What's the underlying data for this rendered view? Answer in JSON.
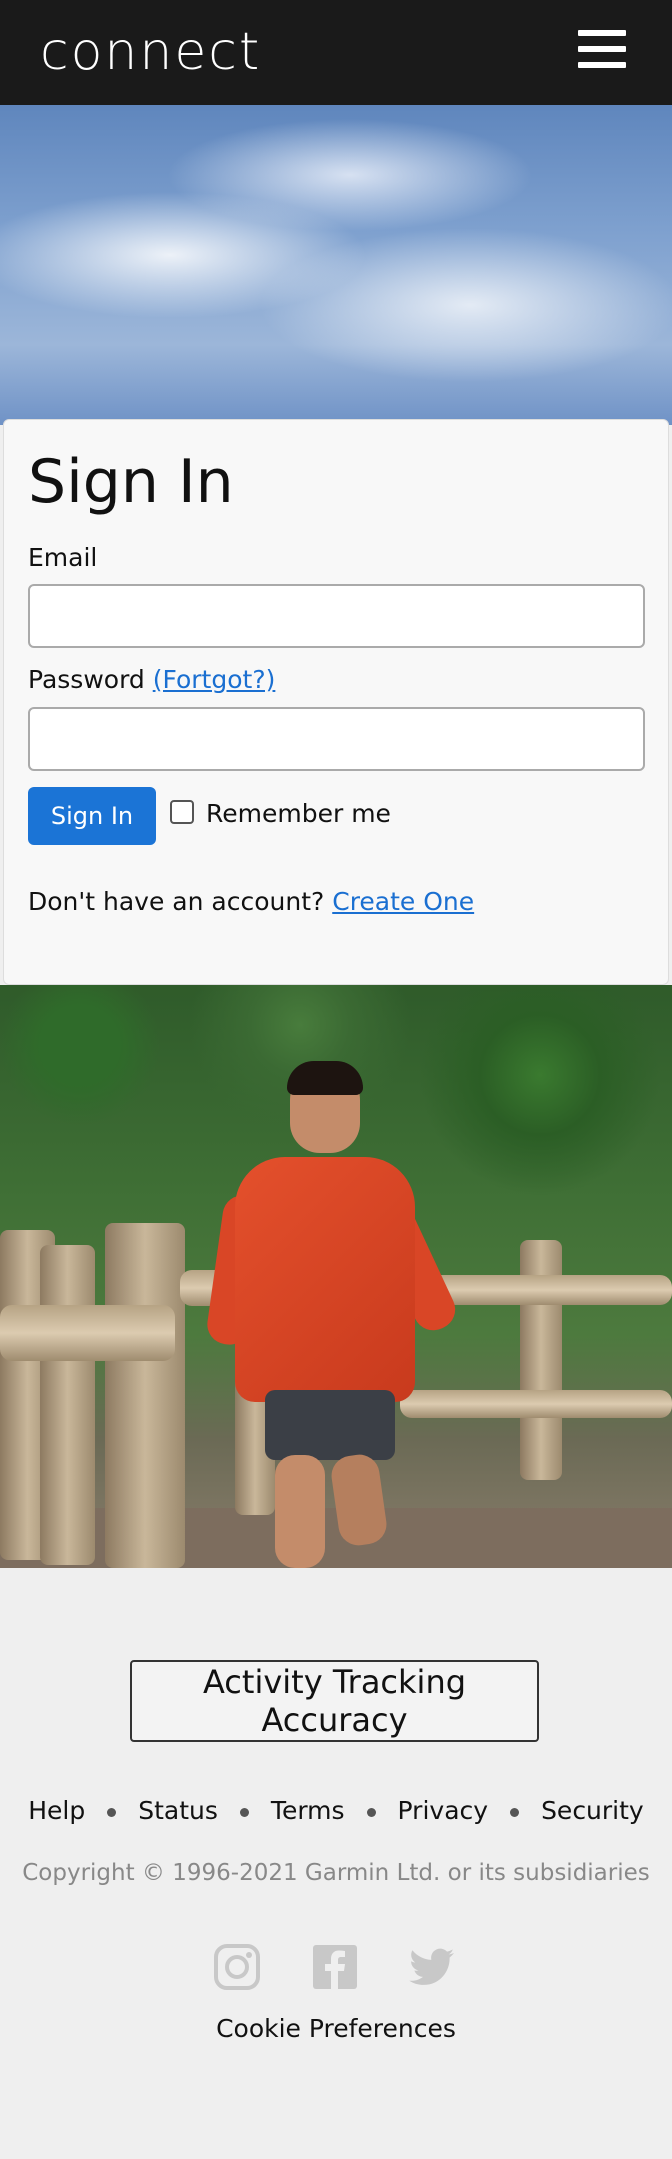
{
  "header": {
    "logo_text": "connect"
  },
  "signin": {
    "title": "Sign In",
    "email_label": "Email",
    "email_value": "",
    "password_label": "Password",
    "forgot_link": "(Fortgot?)",
    "password_value": "",
    "submit_label": "Sign In",
    "remember_label": "Remember me",
    "no_account_text": "Don't have an account?",
    "create_link": "Create One"
  },
  "footer": {
    "accuracy_button": "Activity Tracking Accuracy",
    "links": [
      "Help",
      "Status",
      "Terms",
      "Privacy",
      "Security"
    ],
    "copyright": "Copyright © 1996-2021 Garmin Ltd. or its subsidiaries",
    "social": [
      "instagram-icon",
      "facebook-icon",
      "twitter-icon"
    ],
    "cookie_preferences": "Cookie Preferences"
  },
  "colors": {
    "header_bg": "#1a1a1a",
    "primary_button": "#1b74d6",
    "link": "#1a6fd1",
    "footer_bg": "#efefef"
  }
}
